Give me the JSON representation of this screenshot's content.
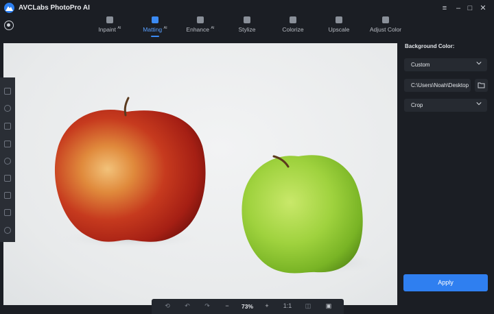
{
  "app": {
    "title": "AVCLabs PhotoPro AI"
  },
  "window_controls": {
    "menu": "≡",
    "minimize": "–",
    "maximize": "□",
    "close": "✕"
  },
  "toolbar": {
    "tools": [
      {
        "label": "Inpaint",
        "badge": "AI",
        "icon": "inpaint-icon"
      },
      {
        "label": "Matting",
        "badge": "AI",
        "icon": "matting-icon",
        "active": true
      },
      {
        "label": "Enhance",
        "badge": "AI",
        "icon": "enhance-icon"
      },
      {
        "label": "Stylize",
        "badge": "",
        "icon": "stylize-icon"
      },
      {
        "label": "Colorize",
        "badge": "",
        "icon": "colorize-icon"
      },
      {
        "label": "Upscale",
        "badge": "",
        "icon": "upscale-icon"
      },
      {
        "label": "Adjust Color",
        "badge": "",
        "icon": "adjust-color-icon"
      }
    ]
  },
  "zoombar": {
    "zoom": "73%",
    "minus": "−",
    "plus": "+",
    "one_to_one": "1:1"
  },
  "panel": {
    "background_label": "Background Color:",
    "background_mode": "Custom",
    "output_path": "C:\\Users\\Noah\\Desktop",
    "crop_mode": "Crop",
    "apply_label": "Apply"
  },
  "colors": {
    "accent": "#2f7ff0",
    "bg": "#1b1e24",
    "panel_field": "#262a31"
  }
}
